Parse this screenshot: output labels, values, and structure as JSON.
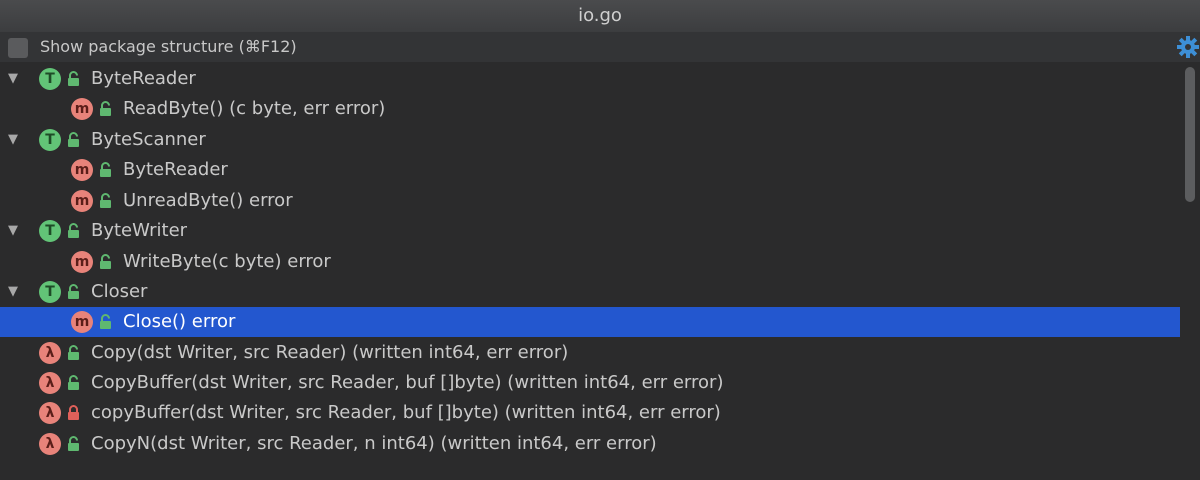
{
  "window": {
    "title": "io.go"
  },
  "options": {
    "show_package_structure_label": "Show package structure (⌘F12)",
    "checked": false,
    "settings_icon": "gear-icon"
  },
  "colors": {
    "selection": "#2357cf",
    "type_badge": "#62c477",
    "method_badge": "#e8837a",
    "public_lock": "#5fb870",
    "private_lock": "#e0605a"
  },
  "tree": {
    "items": [
      {
        "kind": "T",
        "access": "public",
        "label": "ByteReader",
        "expanded": true
      },
      {
        "kind": "m",
        "access": "public",
        "label": "ReadByte() (c byte, err error)"
      },
      {
        "kind": "T",
        "access": "public",
        "label": "ByteScanner",
        "expanded": true
      },
      {
        "kind": "m",
        "access": "public",
        "label": "ByteReader"
      },
      {
        "kind": "m",
        "access": "public",
        "label": "UnreadByte() error"
      },
      {
        "kind": "T",
        "access": "public",
        "label": "ByteWriter",
        "expanded": true
      },
      {
        "kind": "m",
        "access": "public",
        "label": "WriteByte(c byte) error"
      },
      {
        "kind": "T",
        "access": "public",
        "label": "Closer",
        "expanded": true
      },
      {
        "kind": "m",
        "access": "public",
        "label": "Close() error",
        "selected": true
      },
      {
        "kind": "λ",
        "access": "public",
        "label": "Copy(dst Writer, src Reader) (written int64, err error)"
      },
      {
        "kind": "λ",
        "access": "public",
        "label": "CopyBuffer(dst Writer, src Reader, buf []byte) (written int64, err error)"
      },
      {
        "kind": "λ",
        "access": "private",
        "label": "copyBuffer(dst Writer, src Reader, buf []byte) (written int64, err error)"
      },
      {
        "kind": "λ",
        "access": "public",
        "label": "CopyN(dst Writer, src Reader, n int64) (written int64, err error)"
      }
    ]
  }
}
